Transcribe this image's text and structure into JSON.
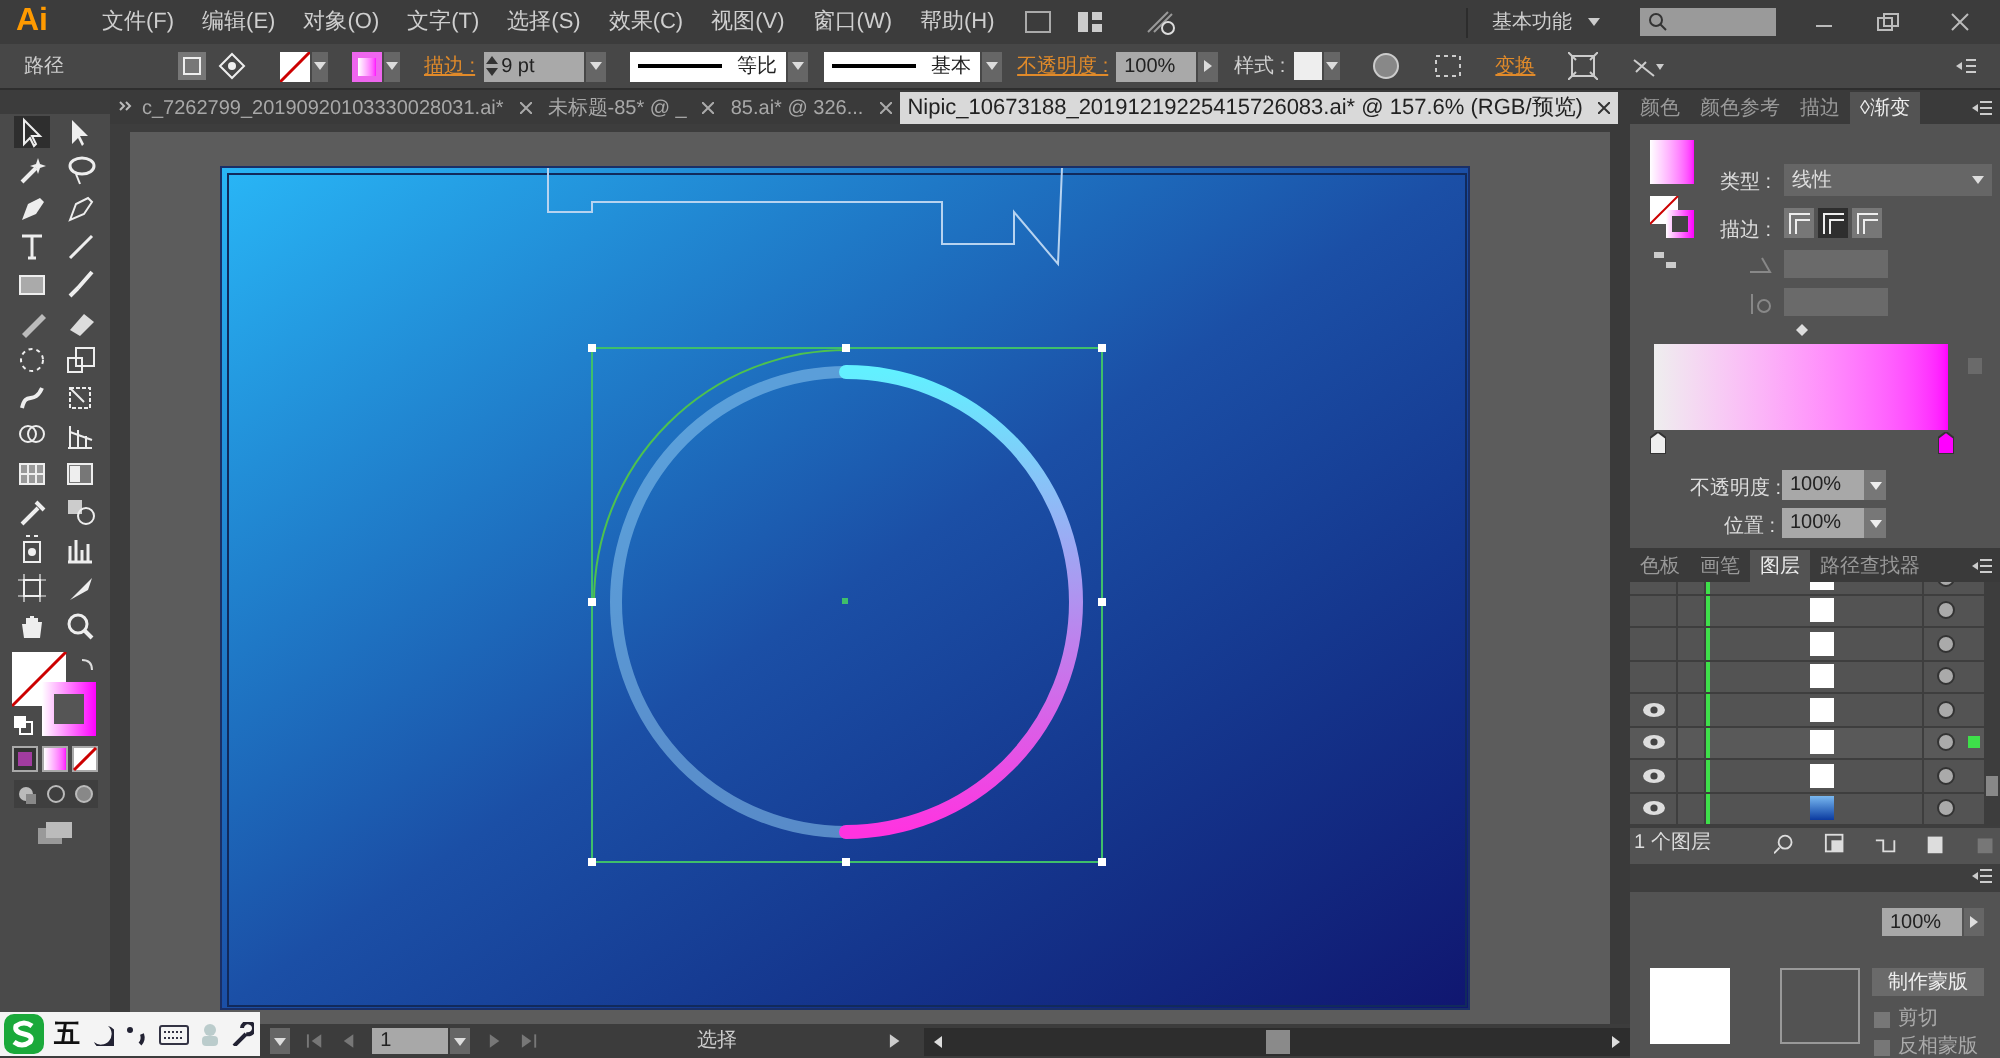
{
  "app": {
    "logo": "Ai"
  },
  "menu": [
    "文件(F)",
    "编辑(E)",
    "对象(O)",
    "文字(T)",
    "选择(S)",
    "效果(C)",
    "视图(V)",
    "窗口(W)",
    "帮助(H)"
  ],
  "workspace": {
    "label": "基本功能"
  },
  "control_bar": {
    "selection": "路径",
    "stroke_label": "描边 :",
    "stroke_weight": "9 pt",
    "profile": "等比",
    "brush": "基本",
    "opacity_label": "不透明度 :",
    "opacity": "100%",
    "style_label": "样式 :",
    "transform": "变换"
  },
  "doc_tabs": [
    {
      "label": "c_7262799_20190920103330028031.ai*",
      "selected": false
    },
    {
      "label": "未标题-85* @ _",
      "selected": false
    },
    {
      "label": "85.ai* @ 326...",
      "selected": false
    },
    {
      "label": "Nipic_10673188_20191219225415726083.ai* @ 157.6% (RGB/预览)",
      "selected": true
    }
  ],
  "gradient_panel": {
    "tabs": [
      {
        "label": "颜色",
        "selected": false
      },
      {
        "label": "颜色参考",
        "selected": false
      },
      {
        "label": "描边",
        "selected": false
      },
      {
        "label": "◊渐变",
        "selected": true
      }
    ],
    "type_label": "类型 :",
    "type": "线性",
    "stroke_label": "描边 :",
    "opacity_label": "不透明度 :",
    "opacity": "100%",
    "location_label": "位置 :",
    "location": "100%"
  },
  "layers_panel": {
    "tabs": [
      {
        "label": "色板",
        "selected": false
      },
      {
        "label": "画笔",
        "selected": false
      },
      {
        "label": "图层",
        "selected": true
      },
      {
        "label": "路径查找器",
        "selected": false
      }
    ],
    "rows": [
      {
        "visible": false,
        "selected": false,
        "kind": "shape"
      },
      {
        "visible": false,
        "selected": false,
        "kind": "shape"
      },
      {
        "visible": false,
        "selected": false,
        "kind": "shape"
      },
      {
        "visible": false,
        "selected": false,
        "kind": "shape"
      },
      {
        "visible": true,
        "selected": false,
        "kind": "shape"
      },
      {
        "visible": true,
        "selected": true,
        "kind": "shape"
      },
      {
        "visible": true,
        "selected": false,
        "kind": "shape"
      },
      {
        "visible": true,
        "selected": false,
        "kind": "background"
      }
    ],
    "footer": "1 个图层"
  },
  "transparency_panel": {
    "opacity": "100%",
    "make_mask": "制作蒙版",
    "clip": "剪切",
    "clip_checked": false,
    "invert": "反相蒙版",
    "invert_checked": false
  },
  "status_bar": {
    "page": "1",
    "tool": "选择"
  },
  "ime_bar": {
    "mode": "五"
  }
}
